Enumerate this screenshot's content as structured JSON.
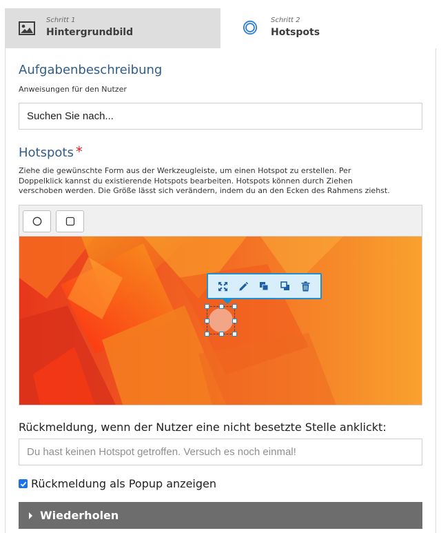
{
  "steps": [
    {
      "small": "Schritt 1",
      "label": "Hintergrundbild",
      "icon": "image-icon",
      "active": false
    },
    {
      "small": "Schritt 2",
      "label": "Hotspots",
      "icon": "target-icon",
      "active": true
    }
  ],
  "task": {
    "title": "Aufgabenbeschreibung",
    "help": "Anweisungen für den Nutzer",
    "value": "Suchen Sie nach..."
  },
  "hotspots": {
    "title": "Hotspots",
    "required_marker": "*",
    "help_lines": [
      "Ziehe die gewünschte Form aus der Werkzeugleiste, um einen Hotspot zu erstellen. Per",
      "Doppelklick kannst du existierende Hotspots bearbeiten. Hotspots können durch Ziehen",
      "verschoben werden. Die Größe lässt sich verändern, indem du an den Ecken des Rahmens ziehst."
    ],
    "tools": [
      "circle-tool-icon",
      "rectangle-tool-icon"
    ],
    "hotspot_actions": [
      "expand-icon",
      "edit-pencil-icon",
      "bring-to-front-icon",
      "send-to-back-icon",
      "trash-icon"
    ],
    "colors": {
      "background_orange": "#f7941d",
      "background_red": "#e8361c",
      "hotspot_fill": "#f2a98e",
      "selection_blue": "#1e8fd4"
    }
  },
  "feedback": {
    "label": "Rückmeldung, wenn der Nutzer eine nicht besetzte Stelle anklickt:",
    "placeholder": "Du hast keinen Hotspot getroffen. Versuch es noch einmal!"
  },
  "popup": {
    "label": "Rückmeldung als Popup anzeigen",
    "checked": true
  },
  "retry": {
    "label": "Wiederholen"
  }
}
